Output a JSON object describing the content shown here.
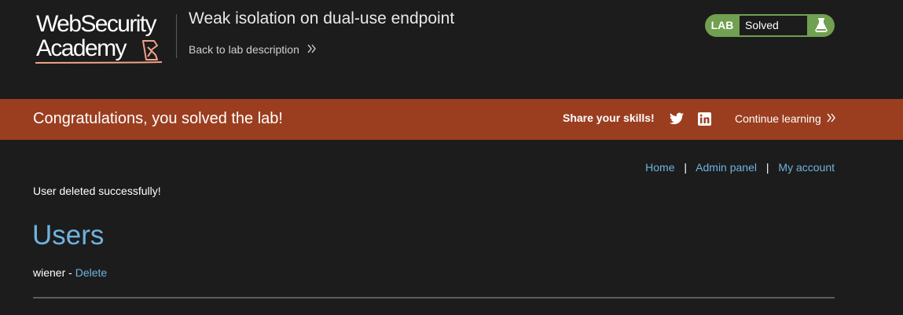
{
  "header": {
    "logo": {
      "line1": "WebSecurity",
      "line2": "Academy"
    },
    "lab_title": "Weak isolation on dual-use endpoint",
    "back_link": "Back to lab description",
    "status": {
      "tag": "LAB",
      "text": "Solved",
      "icon": "flask-icon"
    }
  },
  "banner": {
    "message": "Congratulations, you solved the lab!",
    "share_label": "Share your skills!",
    "icons": [
      "twitter-icon",
      "linkedin-icon"
    ],
    "continue_label": "Continue learning"
  },
  "nav": {
    "home": "Home",
    "separator": "|",
    "admin_panel": "Admin panel",
    "my_account": "My account"
  },
  "content": {
    "flash_message": "User deleted successfully!",
    "heading": "Users",
    "users": [
      {
        "name": "wiener",
        "sep": "-",
        "action": "Delete"
      }
    ]
  },
  "colors": {
    "background": "#1c1c1c",
    "banner": "#9b3e1f",
    "link": "#6fb3e0",
    "lab_solved": "#70a050",
    "logo_accent": "#f0a28a"
  }
}
